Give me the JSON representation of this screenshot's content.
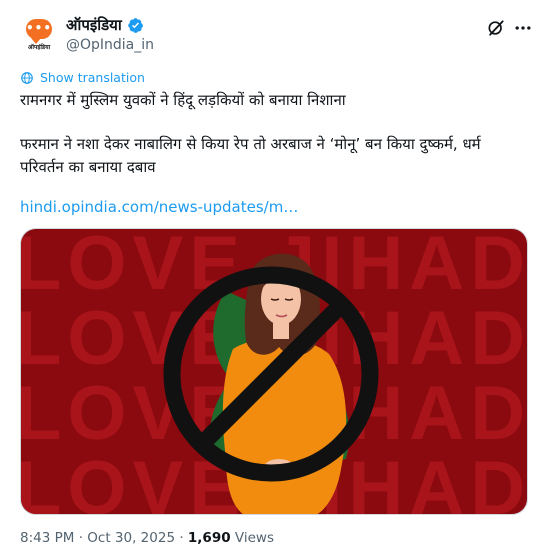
{
  "account": {
    "display_name": "ऑपइंडिया",
    "handle": "@OpIndia_in",
    "avatar_caption": "ऑपइंडिया",
    "avatar_dots": "•••"
  },
  "tweet": {
    "show_translation": "Show translation",
    "headline": "रामनगर में मुस्लिम युवकों ने हिंदू लड़कियों को बनाया निशाना",
    "body_line1": "फरमान ने नशा देकर नाबालिग से किया रेप तो अरबाज ने ‘मोनू’ बन किया दुष्कर्म, धर्म",
    "body_line2": "परिवर्तन का बनाया दबाव",
    "link": "hindi.opindia.com/news-updates/m…"
  },
  "media": {
    "background_text": [
      "LOVE JIHAD",
      "LOVE JIHAD",
      "LOVE JIHAD",
      "LOVE JIHAD"
    ],
    "colors": {
      "background": "#8b0a0f",
      "text": "#a8141a",
      "ban_symbol": "#111111",
      "dress": "#f28c0f",
      "scarf": "#1f6b2e"
    }
  },
  "meta": {
    "time": "8:43 PM",
    "separator": " · ",
    "date": "Oct 30, 2025",
    "views_count": "1,690",
    "views_label": "Views"
  },
  "colors": {
    "accent": "#1d9bf0",
    "brand": "#f36f21",
    "muted": "#536471"
  },
  "icons": [
    "verified-badge-icon",
    "grok-icon",
    "more-icon",
    "translate-globe-icon"
  ]
}
